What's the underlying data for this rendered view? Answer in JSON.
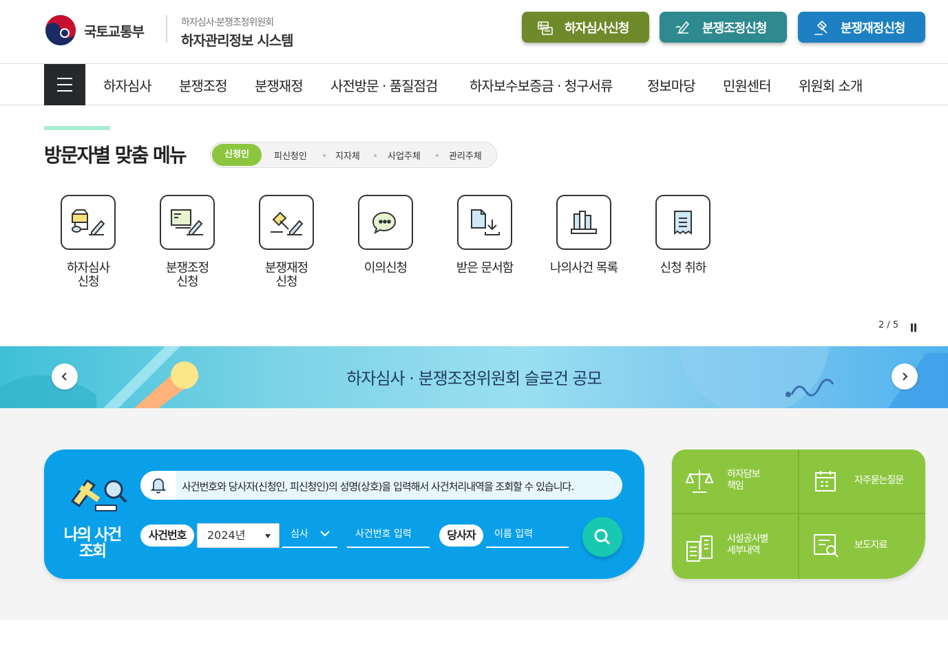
{
  "header": {
    "ministry": "국토교통부",
    "system_line1": "하자심사·분쟁조정위원회",
    "system_line2": "하자관리정보 시스템",
    "buttons": [
      {
        "label": "하자심사신청",
        "color": "#6e8a2a"
      },
      {
        "label": "분쟁조정신청",
        "color": "#2e8a8e"
      },
      {
        "label": "분쟁재정신청",
        "color": "#1d80c3"
      }
    ]
  },
  "gnb": {
    "items": [
      "하자심사",
      "분쟁조정",
      "분쟁재정",
      "사전방문 · 품질점검",
      "하자보수보증금 · 청구서류",
      "정보마당",
      "민원센터",
      "위원회 소개"
    ]
  },
  "visitor_menu": {
    "title": "방문자별 맞춤 메뉴",
    "tabs": [
      "신청인",
      "피신청인",
      "지자체",
      "사업주체",
      "관리주체"
    ],
    "active_tab": "신청인",
    "items": [
      {
        "label": "하자심사\n신청",
        "icon": "apartment-pen-icon"
      },
      {
        "label": "분쟁조정\n신청",
        "icon": "monitor-pen-icon"
      },
      {
        "label": "분쟁재정\n신청",
        "icon": "gavel-pen-icon"
      },
      {
        "label": "이의신청",
        "icon": "speech-bubble-icon"
      },
      {
        "label": "받은 문서함",
        "icon": "document-download-icon"
      },
      {
        "label": "나의사건 목록",
        "icon": "books-icon"
      },
      {
        "label": "신청 취하",
        "icon": "receipt-icon"
      }
    ],
    "pager": "2 / 5"
  },
  "banner": {
    "text": "하자심사 · 분쟁조정위원회 슬로건 공모"
  },
  "case_search": {
    "title": "나의 사건\n조회",
    "notice": "사건번호와 당사자(신청인, 피신청인)의 성명(상호)을 입력해서 사건처리내역을 조회할 수 있습니다.",
    "case_no_label": "사건번호",
    "year_value": "2024년",
    "type_value": "심사",
    "case_no_placeholder": "사건번호 입력",
    "party_label": "당사자",
    "name_placeholder": "이름 입력"
  },
  "quick_links": [
    {
      "label": "하자담보\n책임",
      "icon": "scale-icon"
    },
    {
      "label": "자주묻는질문",
      "icon": "calendar-icon"
    },
    {
      "label": "시설공사별\n세부내역",
      "icon": "clipboard-building-icon"
    },
    {
      "label": "보도자료",
      "icon": "document-search-icon"
    }
  ]
}
